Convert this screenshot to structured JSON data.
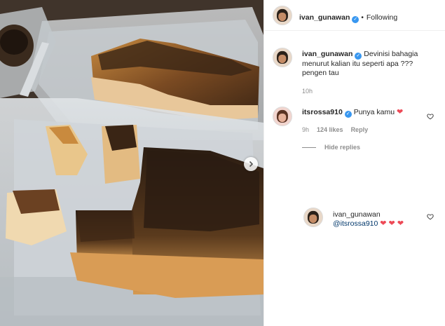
{
  "post": {
    "author": "ivan_gunawan",
    "follow_status": "Following",
    "separator": "•"
  },
  "caption": {
    "author": "ivan_gunawan",
    "text": "Devinisi bahagia menurut kalian itu seperti apa ??? pengen tau",
    "time": "10h"
  },
  "comment": {
    "author": "itsrossa910",
    "text": "Punya kamu",
    "emoji": "❤",
    "time": "9h",
    "likes": "124 likes",
    "reply_label": "Reply",
    "hide_replies_label": "Hide replies"
  },
  "reply": {
    "author": "ivan_gunawan",
    "mention": "@itsrossa910",
    "emoji": "❤ ❤ ❤"
  },
  "icons": {
    "verified": "verified-badge-icon",
    "heart": "heart-outline-icon",
    "next": "chevron-right-icon"
  },
  "colors": {
    "verified_blue": "#3897f0",
    "heart_red": "#ed4956",
    "meta_gray": "#8e8e8e"
  }
}
